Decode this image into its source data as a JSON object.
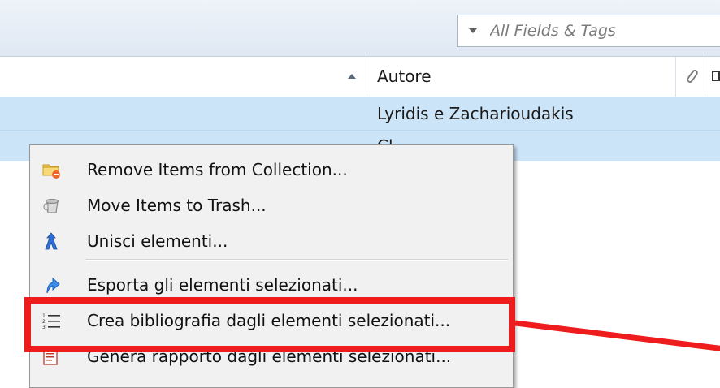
{
  "search": {
    "placeholder": "All Fields & Tags",
    "icon": "dropdown-arrow-icon"
  },
  "columns": {
    "title_sort": "ascending",
    "author_label": "Autore",
    "attachments_icon": "paperclip-icon"
  },
  "items": [
    {
      "author": "Lyridis e Zacharioudakis",
      "selected": true
    },
    {
      "author": "Cl",
      "selected": true
    }
  ],
  "context_menu": {
    "items": [
      {
        "label": "Remove Items from Collection...",
        "icon": "folder-remove-icon"
      },
      {
        "label": "Move Items to Trash...",
        "icon": "trash-icon"
      },
      {
        "label": "Unisci elementi...",
        "icon": "merge-icon"
      },
      {
        "label": "Esporta gli elementi selezionati...",
        "icon": "export-icon"
      },
      {
        "label": "Crea bibliografia dagli elementi selezionati...",
        "icon": "bibliography-list-icon"
      },
      {
        "label": "Genera rapporto dagli elementi selezionati...",
        "icon": "report-icon"
      }
    ]
  },
  "annotation": {
    "highlight_color": "#ee1c1c",
    "highlighted_item": "Crea bibliografia dagli elementi selezionati..."
  },
  "colors": {
    "selection": "#cce4f7",
    "menu_background": "#f1f1f1",
    "toolbar": "#dfe8f3"
  }
}
